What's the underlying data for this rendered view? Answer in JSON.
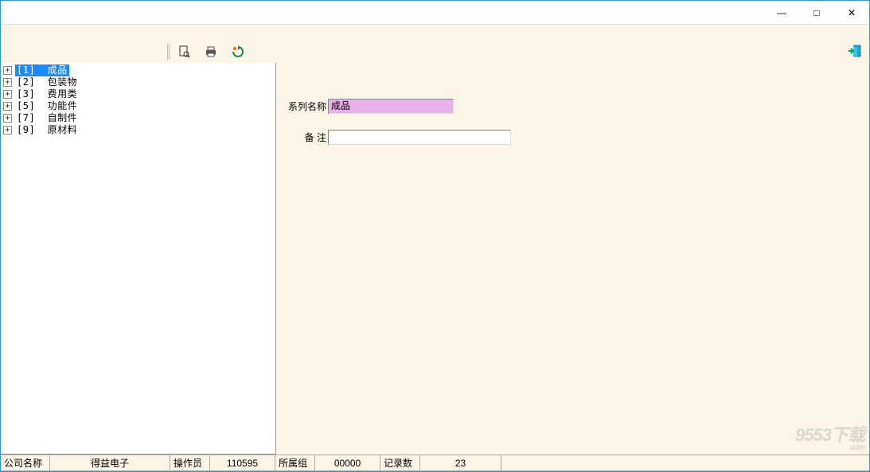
{
  "window": {
    "minimize_glyph": "—",
    "maximize_glyph": "□",
    "close_glyph": "✕"
  },
  "toolbar": {
    "icons": {
      "preview": "print-preview-icon",
      "print": "print-icon",
      "refresh": "refresh-icon",
      "exit": "exit-icon"
    }
  },
  "tree": {
    "items": [
      {
        "key": "[1]",
        "label": "成品",
        "selected": true
      },
      {
        "key": "[2]",
        "label": "包装物",
        "selected": false
      },
      {
        "key": "[3]",
        "label": "费用类",
        "selected": false
      },
      {
        "key": "[5]",
        "label": "功能件",
        "selected": false
      },
      {
        "key": "[7]",
        "label": "自制件",
        "selected": false
      },
      {
        "key": "[9]",
        "label": "原材料",
        "selected": false
      }
    ]
  },
  "form": {
    "series_label": "系列名称",
    "series_value": "成品",
    "remark_label": "备    注",
    "remark_value": ""
  },
  "statusbar": {
    "company_label": "公司名称",
    "company_value": "得益电子",
    "operator_label": "操作员",
    "operator_value": "110595",
    "group_label": "所属组",
    "group_value": "00000",
    "records_label": "记录数",
    "records_value": "23"
  },
  "watermark": {
    "text": "9553下载",
    "sub": ".com"
  }
}
